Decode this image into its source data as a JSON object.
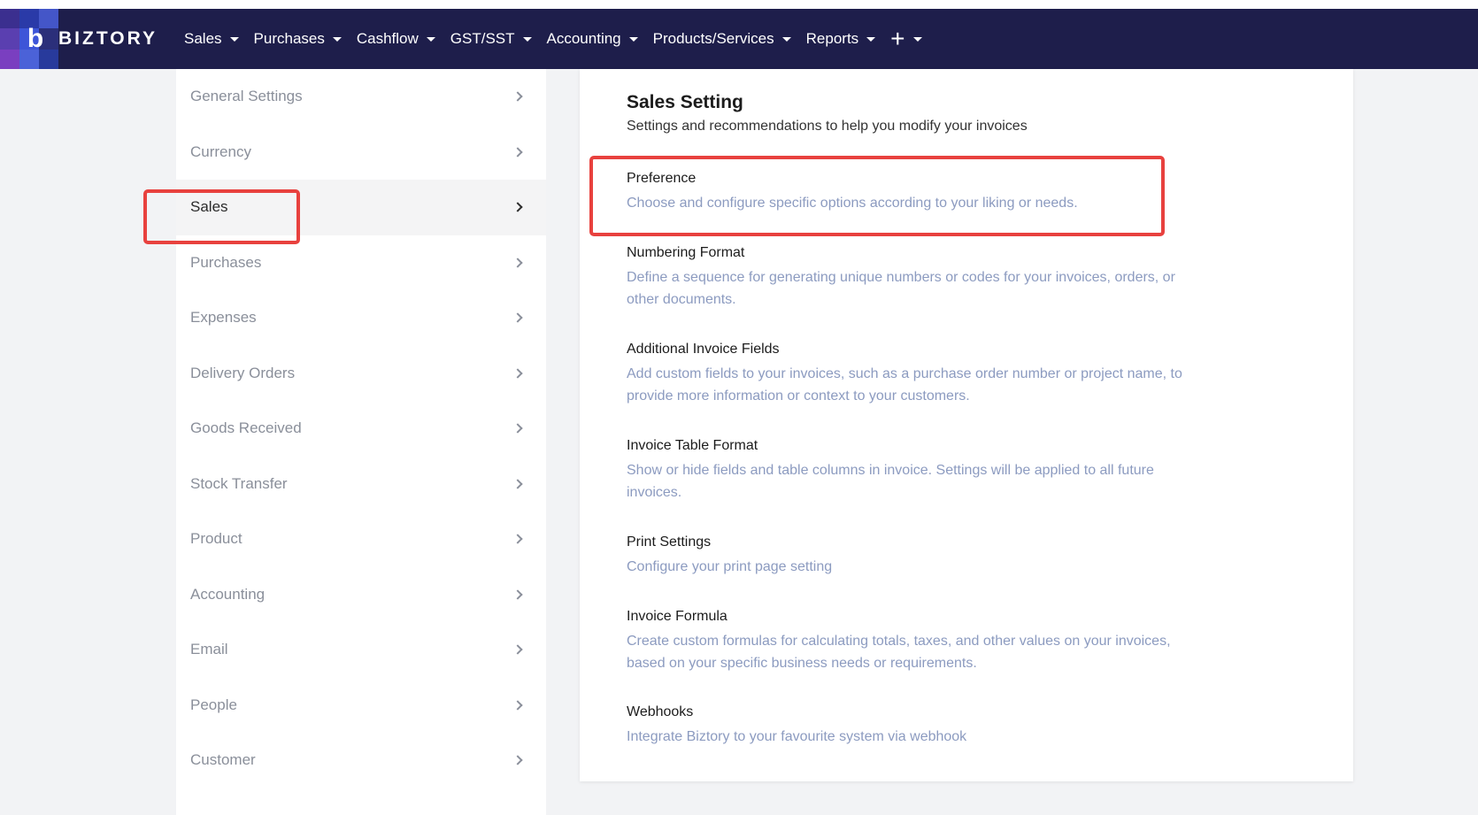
{
  "brand": {
    "name": "BIZTORY"
  },
  "nav": {
    "items": [
      {
        "label": "Sales"
      },
      {
        "label": "Purchases"
      },
      {
        "label": "Cashflow"
      },
      {
        "label": "GST/SST"
      },
      {
        "label": "Accounting"
      },
      {
        "label": "Products/Services"
      },
      {
        "label": "Reports"
      }
    ],
    "add_icon": "+"
  },
  "sidebar": {
    "items": [
      {
        "label": "General Settings"
      },
      {
        "label": "Currency"
      },
      {
        "label": "Sales",
        "active": true
      },
      {
        "label": "Purchases"
      },
      {
        "label": "Expenses"
      },
      {
        "label": "Delivery Orders"
      },
      {
        "label": "Goods Received"
      },
      {
        "label": "Stock Transfer"
      },
      {
        "label": "Product"
      },
      {
        "label": "Accounting"
      },
      {
        "label": "Email"
      },
      {
        "label": "People"
      },
      {
        "label": "Customer"
      }
    ]
  },
  "main": {
    "title": "Sales Setting",
    "subtitle": "Settings and recommendations to help you modify your invoices",
    "sections": [
      {
        "title": "Preference",
        "desc": "Choose and configure specific options according to your liking or needs."
      },
      {
        "title": "Numbering Format",
        "desc": "Define a sequence for generating unique numbers or codes for your invoices, orders, or other documents."
      },
      {
        "title": "Additional Invoice Fields",
        "desc": "Add custom fields to your invoices, such as a purchase order number or project name, to provide more information or context to your customers."
      },
      {
        "title": "Invoice Table Format",
        "desc": "Show or hide fields and table columns in invoice. Settings will be applied to all future invoices."
      },
      {
        "title": "Print Settings",
        "desc": "Configure your print page setting"
      },
      {
        "title": "Invoice Formula",
        "desc": "Create custom formulas for calculating totals, taxes, and other values on your invoices, based on your specific business needs or requirements."
      },
      {
        "title": "Webhooks",
        "desc": "Integrate Biztory to your favourite system via webhook"
      }
    ]
  },
  "colors": {
    "navbar": "#1e1e4b",
    "highlight": "#e8413e",
    "muted_text": "#8c9bc0"
  }
}
